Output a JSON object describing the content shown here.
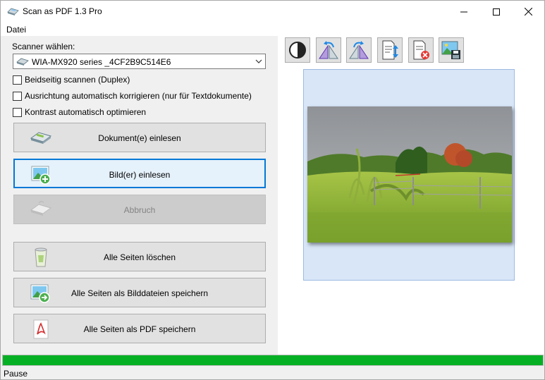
{
  "window": {
    "title": "Scan as PDF 1.3 Pro",
    "controls": [
      "minimize",
      "maximize",
      "close"
    ]
  },
  "menu": {
    "items": [
      "Datei"
    ]
  },
  "scanner": {
    "label": "Scanner wählen:",
    "selected": "WIA-MX920 series _4CF2B9C514E6"
  },
  "options": [
    {
      "label": "Beidseitig scannen (Duplex)",
      "checked": false
    },
    {
      "label": "Ausrichtung automatisch korrigieren (nur für Textdokumente)",
      "checked": false
    },
    {
      "label": "Kontrast automatisch optimieren",
      "checked": false
    }
  ],
  "buttons": {
    "scan_documents": "Dokument(e) einlesen",
    "scan_images": "Bild(er) einlesen",
    "cancel": "Abbruch",
    "delete_all": "Alle Seiten löschen",
    "save_images": "Alle Seiten als Bilddateien speichern",
    "save_pdf": "Alle Seiten als PDF speichern"
  },
  "toolbar": {
    "icons": [
      "contrast-icon",
      "rotate-left-icon",
      "rotate-right-icon",
      "move-page-icon",
      "delete-page-icon",
      "save-image-icon"
    ]
  },
  "progress": {
    "value": 1.0
  },
  "status": {
    "text": "Pause"
  },
  "colors": {
    "accent": "#0078d7",
    "progress": "#06b025"
  }
}
